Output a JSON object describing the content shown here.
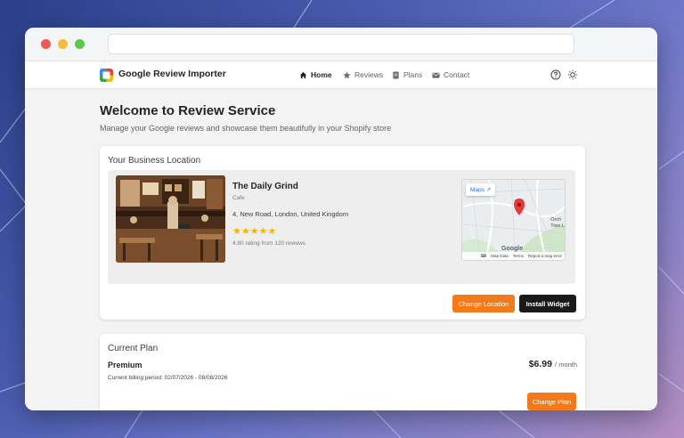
{
  "brand": {
    "name": "Google Review Importer"
  },
  "nav": {
    "items": [
      {
        "label": "Home",
        "icon": "home-icon",
        "active": true
      },
      {
        "label": "Reviews",
        "icon": "star-icon",
        "active": false
      },
      {
        "label": "Plans",
        "icon": "document-icon",
        "active": false
      },
      {
        "label": "Contact",
        "icon": "mail-icon",
        "active": false
      }
    ],
    "right_icons": [
      "help-icon",
      "sun-icon"
    ]
  },
  "page": {
    "title": "Welcome to Review Service",
    "subtitle": "Manage your Google reviews and showcase them beautifully in your Shopify store"
  },
  "location": {
    "title": "Your Business Location",
    "business_name": "The Daily Grind",
    "category": "Cafe",
    "address": "4, New Road, London, United Kingdom",
    "stars": "★★★★★",
    "rating_text": "4.80 rating from 120 reviews",
    "map": {
      "maps_label": "Maps",
      "city_label_1": "Orch",
      "city_label_2": "Tree L",
      "google_label": "Google",
      "footer": {
        "map_data": "Map Data",
        "terms": "Terms",
        "report": "Report a map error"
      }
    },
    "change_button": "Change Location",
    "install_button": "Install Widget"
  },
  "plan": {
    "title": "Current Plan",
    "name": "Premium",
    "price": "$6.99",
    "period": "/ month",
    "billing_label": "Current billing period:",
    "billing_range": "02/07/2026 - 08/08/2026",
    "change_button": "Change Plan"
  },
  "colors": {
    "accent": "#f27a1a",
    "dark_button": "#1a1a1a",
    "star": "#f4b400",
    "map_pin": "#e53935"
  }
}
